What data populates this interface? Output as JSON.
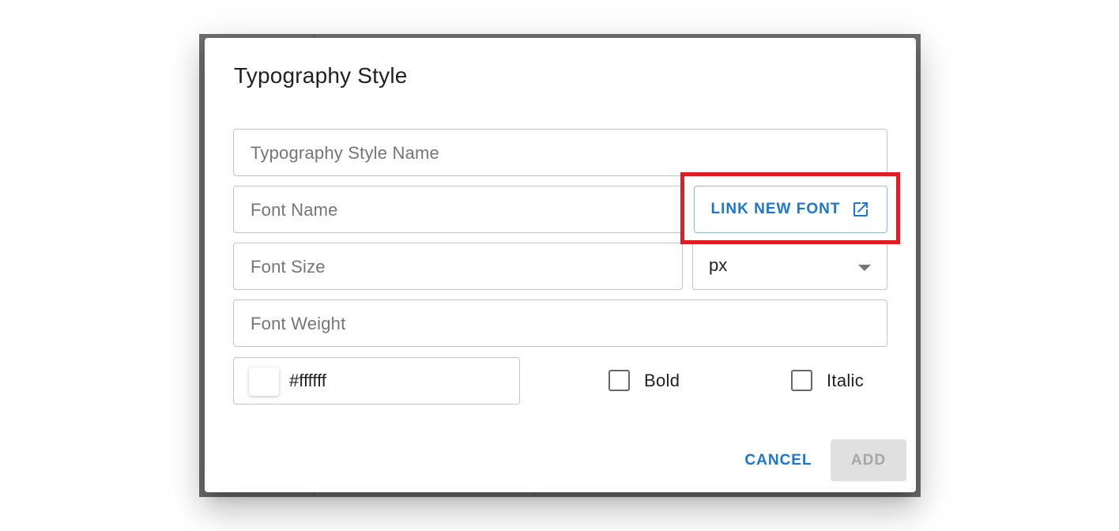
{
  "dialog": {
    "title": "Typography Style",
    "fields": {
      "style_name": {
        "placeholder": "Typography Style Name",
        "value": ""
      },
      "font_name": {
        "placeholder": "Font Name",
        "value": ""
      },
      "font_size": {
        "placeholder": "Font Size",
        "value": ""
      },
      "font_size_unit": {
        "selected": "px"
      },
      "font_weight": {
        "placeholder": "Font Weight",
        "value": ""
      },
      "color": {
        "value": "#ffffff",
        "swatch_color": "#ffffff"
      }
    },
    "link_font_button": {
      "label": "LINK NEW FONT",
      "icon": "open-in-new-icon"
    },
    "checkboxes": {
      "bold": {
        "label": "Bold",
        "checked": false
      },
      "italic": {
        "label": "Italic",
        "checked": false
      }
    },
    "actions": {
      "cancel": "CANCEL",
      "add": "ADD"
    }
  },
  "colors": {
    "accent": "#1976d2",
    "highlight": "#e31b23",
    "disabled_bg": "#e0e0e0",
    "disabled_text": "#a6a6a6"
  }
}
